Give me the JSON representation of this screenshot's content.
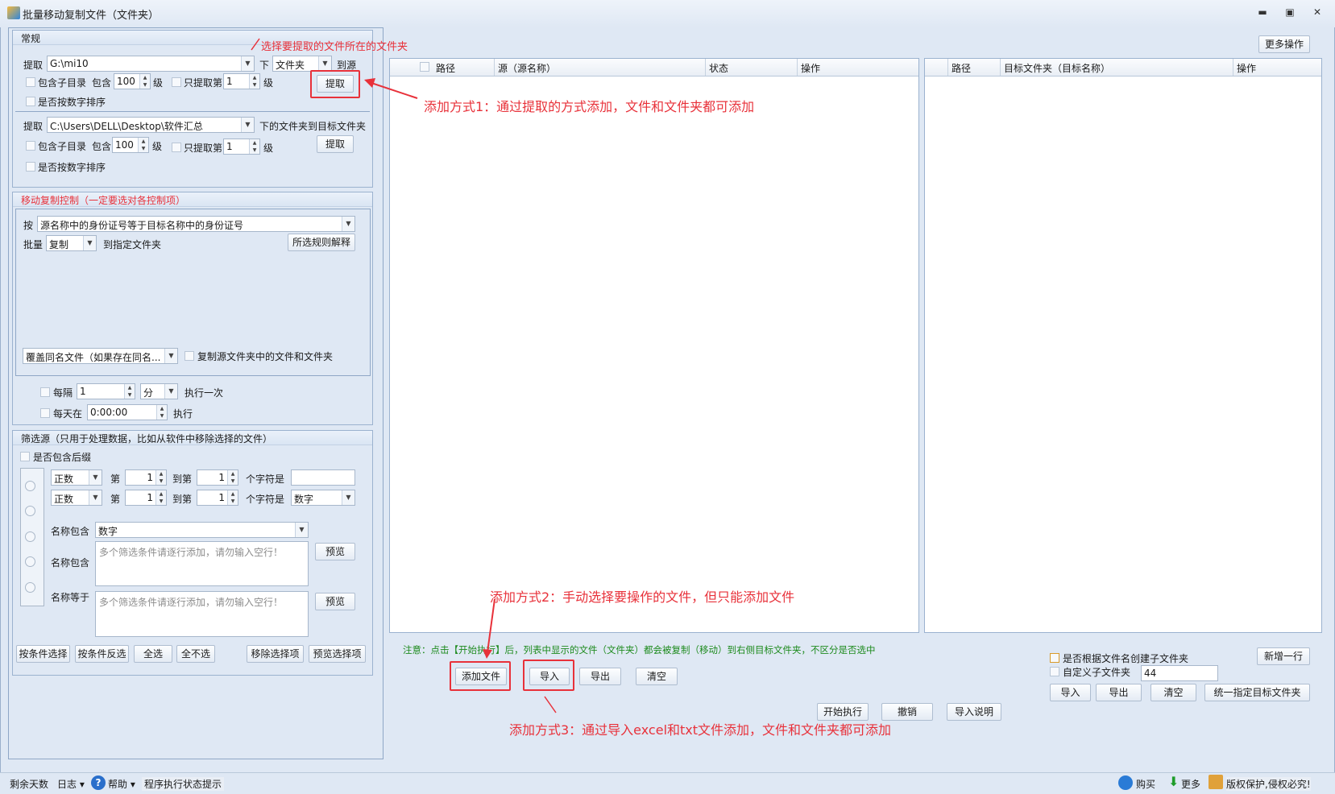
{
  "window": {
    "title": "批量移动复制文件（文件夹）",
    "min": "▬",
    "max": "▣",
    "close": "✕"
  },
  "top": {
    "more_ops": "更多操作"
  },
  "general": {
    "header": "常规",
    "row1": {
      "extract": "提取",
      "path": "G:\\mi10",
      "down": "下",
      "type": "文件夹",
      "to_source": "到源"
    },
    "row2": {
      "include_sub": "包含子目录",
      "include": "包含",
      "levels": "100",
      "level": "级",
      "only_extract": "只提取第",
      "nth": "1",
      "level2": "级",
      "button": "提取"
    },
    "row3": {
      "sort_num": "是否按数字排序"
    },
    "row4": {
      "extract": "提取",
      "path": "C:\\Users\\DELL\\Desktop\\软件汇总",
      "suffix": "下的文件夹到目标文件夹"
    },
    "row5": {
      "include_sub": "包含子目录",
      "include": "包含",
      "levels": "100",
      "level": "级",
      "only_extract": "只提取第",
      "nth": "1",
      "level2": "级",
      "button": "提取"
    },
    "row6": {
      "sort_num": "是否按数字排序"
    }
  },
  "move": {
    "header": "移动复制控制（一定要选对各控制项）",
    "by": "按",
    "rule": "源名称中的身份证号等于目标名称中的身份证号",
    "batch": "批量",
    "mode": "复制",
    "to_folder": "到指定文件夹",
    "explain": "所选规则解释",
    "overwrite": "覆盖同名文件（如果存在同名...",
    "copy_contents": "复制源文件夹中的文件和文件夹",
    "every": "每隔",
    "every_val": "1",
    "unit": "分",
    "exec_once": "执行一次",
    "daily": "每天在",
    "daily_val": "0:00:00",
    "exec": "执行"
  },
  "filter": {
    "header": "筛选源（只用于处理数据，比如从软件中移除选择的文件）",
    "include_ext": "是否包含后缀",
    "r1": {
      "mode": "正数",
      "nth": "第",
      "a": "1",
      "to": "到第",
      "b": "1",
      "chars": "个字符是",
      "val": ""
    },
    "r2": {
      "mode": "正数",
      "nth": "第",
      "a": "1",
      "to": "到第",
      "b": "1",
      "chars": "个字符是",
      "val": "数字"
    },
    "r3": {
      "label": "名称包含",
      "val": "数字"
    },
    "r4": {
      "label": "名称包含",
      "placeholder": "多个筛选条件请逐行添加，请勿输入空行！",
      "btn": "预览"
    },
    "r5": {
      "label": "名称等于",
      "placeholder": "多个筛选条件请逐行添加，请勿输入空行！",
      "btn": "预览"
    },
    "buttons": [
      "按条件选择",
      "按条件反选",
      "全选",
      "全不选",
      "移除选择项",
      "预览选择项"
    ]
  },
  "left_grid": {
    "cols": [
      "路径",
      "源（源名称）",
      "状态",
      "操作"
    ]
  },
  "right_grid": {
    "cols": [
      "路径",
      "目标文件夹（目标名称）",
      "操作"
    ]
  },
  "notice": "注意：点击【开始执行】后，列表中显示的文件（文件夹）都会被复制（移动）到右侧目标文件夹，不区分是否选中",
  "left_btns": {
    "add": "添加文件",
    "import": "导入",
    "export": "导出",
    "clear": "清空"
  },
  "right_ops": {
    "by_name": "是否根据文件名创建子文件夹",
    "custom": "自定义子文件夹",
    "custom_val": "44",
    "new_row": "新增一行",
    "import": "导入",
    "export": "导出",
    "clear": "清空",
    "unify": "统一指定目标文件夹"
  },
  "actions": {
    "start": "开始执行",
    "cancel": "撤销",
    "import_help": "导入说明"
  },
  "callouts": {
    "c0": "选择要提取的文件所在的文件夹",
    "c1": "添加方式1：通过提取的方式添加，文件和文件夹都可添加",
    "c2": "添加方式2：手动选择要操作的文件，但只能添加文件",
    "c3": "添加方式3：通过导入excel和txt文件添加，文件和文件夹都可添加"
  },
  "status": {
    "days": "剩余天数",
    "log": "日志",
    "help": "帮助",
    "state": "程序执行状态提示",
    "buy": "购买",
    "more": "更多",
    "copyright": "版权保护,侵权必究!"
  }
}
